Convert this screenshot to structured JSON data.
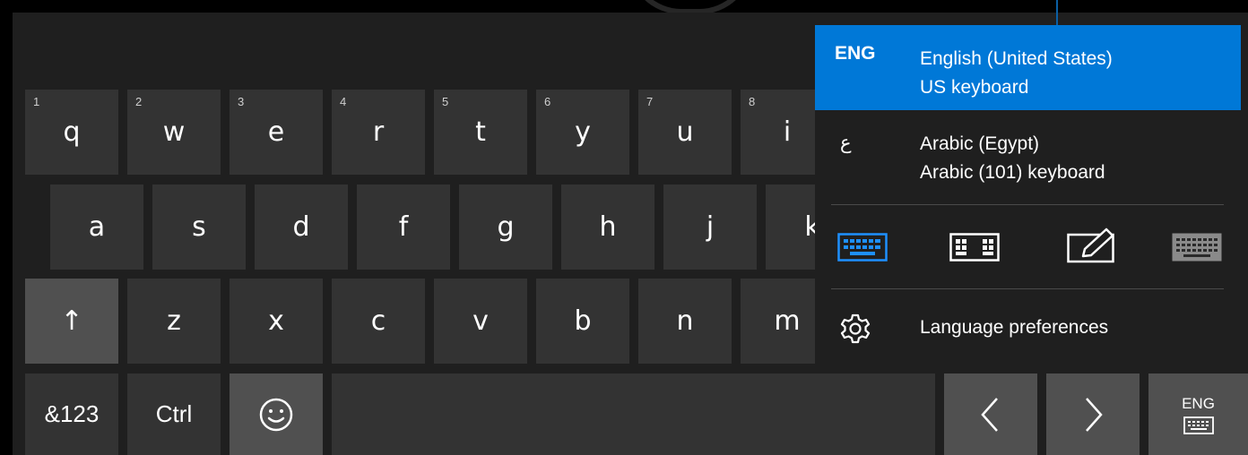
{
  "keyboard": {
    "row1": [
      {
        "num": "1",
        "label": "q"
      },
      {
        "num": "2",
        "label": "w"
      },
      {
        "num": "3",
        "label": "e"
      },
      {
        "num": "4",
        "label": "r"
      },
      {
        "num": "5",
        "label": "t"
      },
      {
        "num": "6",
        "label": "y"
      },
      {
        "num": "7",
        "label": "u"
      },
      {
        "num": "8",
        "label": "i"
      }
    ],
    "row2": [
      "a",
      "s",
      "d",
      "f",
      "g",
      "h",
      "j",
      "k"
    ],
    "row3": [
      "z",
      "x",
      "c",
      "v",
      "b",
      "n",
      "m"
    ],
    "shift_label": "↑",
    "symbols_label": "&123",
    "ctrl_label": "Ctrl",
    "emoji_label": "☺",
    "left_arrow_label": "‹",
    "right_arrow_label": "›",
    "lang_key_label": "ENG"
  },
  "language_panel": {
    "items": [
      {
        "code": "ENG",
        "name": "English (United States)",
        "layout": "US keyboard",
        "selected": true
      },
      {
        "code": "ع",
        "name": "Arabic (Egypt)",
        "layout": "Arabic (101) keyboard",
        "selected": false
      }
    ],
    "modes": [
      {
        "icon": "standard-keyboard-icon",
        "active": true
      },
      {
        "icon": "split-keyboard-icon",
        "active": false
      },
      {
        "icon": "handwriting-icon",
        "active": false
      },
      {
        "icon": "full-keyboard-icon",
        "active": false
      }
    ],
    "preferences_label": "Language preferences"
  },
  "colors": {
    "accent": "#0078d7",
    "key": "#333333",
    "key_light": "#505050",
    "background": "#1f1f1f"
  }
}
